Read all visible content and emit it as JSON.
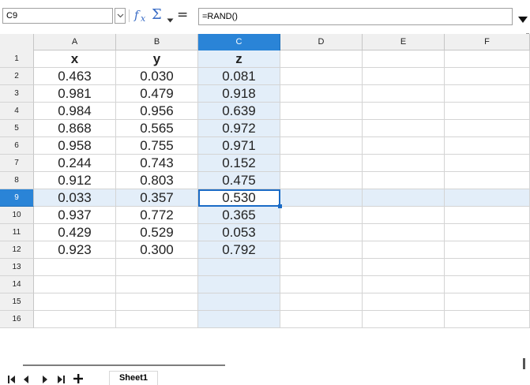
{
  "formula_bar": {
    "name_box": "C9",
    "formula": "=RAND()"
  },
  "columns": [
    "A",
    "B",
    "C",
    "D",
    "E",
    "F"
  ],
  "rows": [
    {
      "num": "1",
      "cells": [
        "x",
        "y",
        "z"
      ]
    },
    {
      "num": "2",
      "cells": [
        "0.463",
        "0.030",
        "0.081"
      ]
    },
    {
      "num": "3",
      "cells": [
        "0.981",
        "0.479",
        "0.918"
      ]
    },
    {
      "num": "4",
      "cells": [
        "0.984",
        "0.956",
        "0.639"
      ]
    },
    {
      "num": "5",
      "cells": [
        "0.868",
        "0.565",
        "0.972"
      ]
    },
    {
      "num": "6",
      "cells": [
        "0.958",
        "0.755",
        "0.971"
      ]
    },
    {
      "num": "7",
      "cells": [
        "0.244",
        "0.743",
        "0.152"
      ]
    },
    {
      "num": "8",
      "cells": [
        "0.912",
        "0.803",
        "0.475"
      ]
    },
    {
      "num": "9",
      "cells": [
        "0.033",
        "0.357",
        "0.530"
      ]
    },
    {
      "num": "10",
      "cells": [
        "0.937",
        "0.772",
        "0.365"
      ]
    },
    {
      "num": "11",
      "cells": [
        "0.429",
        "0.529",
        "0.053"
      ]
    },
    {
      "num": "12",
      "cells": [
        "0.923",
        "0.300",
        "0.792"
      ]
    },
    {
      "num": "13",
      "cells": [
        "",
        "",
        ""
      ]
    },
    {
      "num": "14",
      "cells": [
        "",
        "",
        ""
      ]
    },
    {
      "num": "15",
      "cells": [
        "",
        "",
        ""
      ]
    },
    {
      "num": "16",
      "cells": [
        "",
        "",
        ""
      ]
    }
  ],
  "selection": {
    "row": "9",
    "column": "C"
  },
  "sheet_tabs": [
    "Sheet1"
  ],
  "icons": {
    "name_box_dropdown": "chevron-down-icon",
    "function_wizard": "fx-icon",
    "sum": "sigma-icon",
    "formula": "equals-icon",
    "expand": "triangle-down-icon",
    "first_sheet": "first-sheet-icon",
    "prev_sheet": "prev-sheet-icon",
    "next_sheet": "next-sheet-icon",
    "last_sheet": "last-sheet-icon",
    "add_sheet": "plus-icon"
  },
  "colors": {
    "accent": "#2a84d7",
    "selection_fill": "#e3eef9",
    "cursor_border": "#1a6bc6",
    "header_bg": "#f0f0f0"
  }
}
